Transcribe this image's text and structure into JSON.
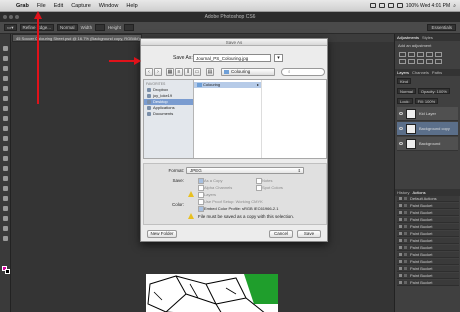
{
  "menubar": {
    "apple": "",
    "items": [
      "Grab",
      "File",
      "Edit",
      "Capture",
      "Window",
      "Help"
    ],
    "status_text": "100% Wed 4:01 PM"
  },
  "window": {
    "title": "Adobe Photoshop CS6"
  },
  "options_bar": {
    "label1": "Refine Edge...",
    "label2": "Normal",
    "label3": "Width",
    "label4": "Height",
    "essentials": "Essentials"
  },
  "document_tab": "45 Soccer Colouring Sheet.psd @ 16.7% (Background copy, RGB/8#)",
  "dialog": {
    "title": "Save As",
    "save_as_label": "Save As:",
    "filename": "Journal_PS_Colouring.jpg",
    "current_folder": "Colouring",
    "search_placeholder": "",
    "sidebar": {
      "favorites_header": "FAVORITES",
      "items": [
        {
          "label": "Dropbox",
          "selected": false
        },
        {
          "label": "joy_loke19",
          "selected": false
        },
        {
          "label": "Desktop",
          "selected": true
        },
        {
          "label": "Applications",
          "selected": false
        },
        {
          "label": "Documents",
          "selected": false
        }
      ]
    },
    "column1_rows": [
      {
        "label": "Colouring",
        "selected": true
      }
    ],
    "format_label": "Format:",
    "format_value": "JPEG",
    "save_label": "Save:",
    "save_options": [
      {
        "label": "As a Copy",
        "checked": true
      },
      {
        "label": "Notes",
        "checked": false
      },
      {
        "label": "Alpha Channels",
        "checked": false
      },
      {
        "label": "Spot Colors",
        "checked": false
      },
      {
        "label": "Layers",
        "checked": false
      }
    ],
    "color_label": "Color:",
    "color_options": [
      {
        "label": "Use Proof Setup:  Working CMYK",
        "checked": false
      },
      {
        "label": "Embed Color Profile:  sRGB IEC61966-2.1",
        "checked": true
      }
    ],
    "warning_text": "File must be saved as a copy with this selection.",
    "new_folder_button": "New Folder",
    "cancel_button": "Cancel",
    "save_button": "Save"
  },
  "panels": {
    "top_tabs": [
      "Adjustments",
      "Styles"
    ],
    "add_adjustment": "Add an adjustment",
    "layers_tabs": [
      "Layers",
      "Channels",
      "Paths"
    ],
    "kind": "Kind",
    "blend_mode": "Normal",
    "opacity": "Opacity: 100%",
    "lock": "Lock:",
    "fill": "Fill: 100%",
    "layers": [
      {
        "name": "Kid Layer",
        "selected": false
      },
      {
        "name": "Background copy",
        "selected": true
      },
      {
        "name": "Background",
        "selected": false
      }
    ],
    "actions_tabs": [
      "History",
      "Actions"
    ],
    "actions_title": "Default Actions",
    "actions": [
      "Paint Bucket",
      "Paint Bucket",
      "Paint Bucket",
      "Paint Bucket",
      "Paint Bucket",
      "Paint Bucket",
      "Paint Bucket",
      "Paint Bucket",
      "Paint Bucket",
      "Paint Bucket",
      "Paint Bucket",
      "Paint Bucket"
    ]
  },
  "colors": {
    "arrow": "#e0121a",
    "foreground_swatch": "#d400a0"
  }
}
